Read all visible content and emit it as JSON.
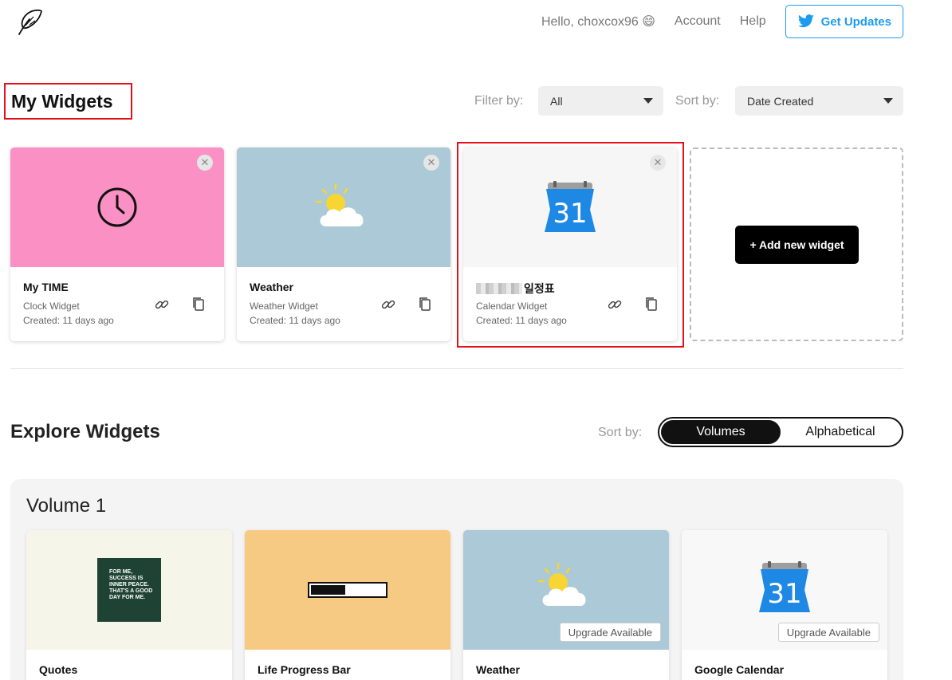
{
  "header": {
    "greeting": "Hello, choxcox96 😄",
    "account": "Account",
    "help": "Help",
    "updates": "Get Updates"
  },
  "my_widgets": {
    "title": "My Widgets",
    "filter_label": "Filter by:",
    "filter_value": "All",
    "sort_label": "Sort by:",
    "sort_value": "Date Created",
    "cards": [
      {
        "name": "My TIME",
        "type": "Clock Widget",
        "created": "Created: 11 days ago",
        "thumb_color": "#fa90c3",
        "icon": "clock-icon"
      },
      {
        "name": "Weather",
        "type": "Weather Widget",
        "created": "Created: 11 days ago",
        "thumb_color": "#abc9d6",
        "icon": "sun-cloud-icon"
      },
      {
        "name": "일정표",
        "type": "Calendar Widget",
        "created": "Created: 11 days ago",
        "thumb_color": "#f6f6f6",
        "icon": "calendar-31-icon"
      }
    ],
    "add_label": "+ Add new widget"
  },
  "explore": {
    "title": "Explore Widgets",
    "sort_label": "Sort by:",
    "sort_options": [
      "Volumes",
      "Alphabetical"
    ],
    "volume_title": "Volume 1",
    "quote_text": "FOR ME, SUCCESS IS INNER PEACE. THAT'S A GOOD DAY FOR ME.",
    "cards": [
      {
        "name": "Quotes",
        "thumb_color": "#f5f5ea",
        "icon": "quote-poster-icon"
      },
      {
        "name": "Life Progress Bar",
        "thumb_color": "#f7ca84",
        "icon": "progress-bar-icon"
      },
      {
        "name": "Weather",
        "thumb_color": "#abc9d6",
        "icon": "sun-cloud-icon",
        "upgrade": "Upgrade Available"
      },
      {
        "name": "Google Calendar",
        "thumb_color": "#f8f8f8",
        "icon": "calendar-31-icon",
        "upgrade": "Upgrade Available"
      }
    ],
    "progress_fraction": 0.47
  },
  "colors": {
    "accent_red": "#e3101b",
    "twitter_blue": "#1d9bf0",
    "calendar_blue": "#1e88e5"
  }
}
